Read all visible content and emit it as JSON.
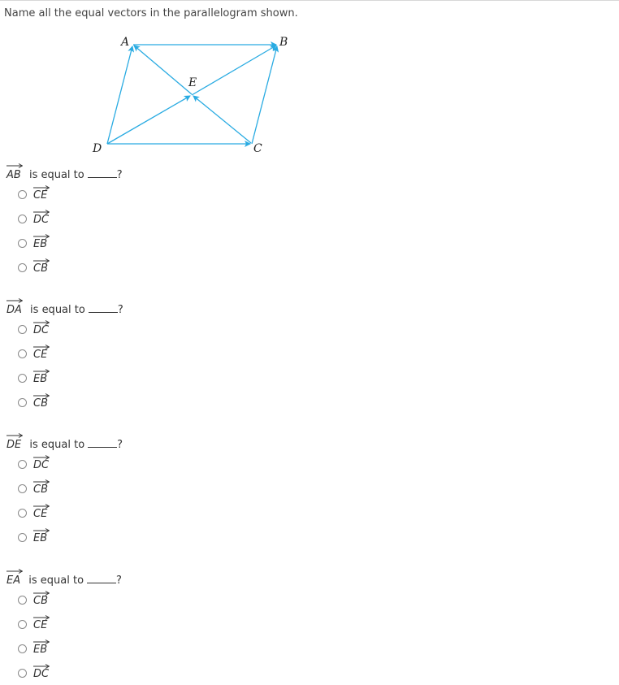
{
  "prompt": "Name all the equal vectors in the parallelogram shown.",
  "figure": {
    "points": {
      "A": "A",
      "B": "B",
      "C": "C",
      "D": "D",
      "E": "E"
    },
    "vectors": [
      "AB",
      "DA",
      "CB",
      "DC",
      "DE",
      "EB",
      "CE",
      "EA"
    ],
    "line_color": "#29abe2"
  },
  "questions": [
    {
      "vector": "AB",
      "text": "is equal to",
      "suffix": "?",
      "options": [
        "CE",
        "DC",
        "EB",
        "CB"
      ]
    },
    {
      "vector": "DA",
      "text": "is equal to",
      "suffix": "?",
      "options": [
        "DC",
        "CE",
        "EB",
        "CB"
      ]
    },
    {
      "vector": "DE",
      "text": "is equal to",
      "suffix": "?",
      "options": [
        "DC",
        "CB",
        "CE",
        "EB"
      ]
    },
    {
      "vector": "EA",
      "text": "is equal to",
      "suffix": "?",
      "options": [
        "CB",
        "CE",
        "EB",
        "DC"
      ]
    }
  ]
}
